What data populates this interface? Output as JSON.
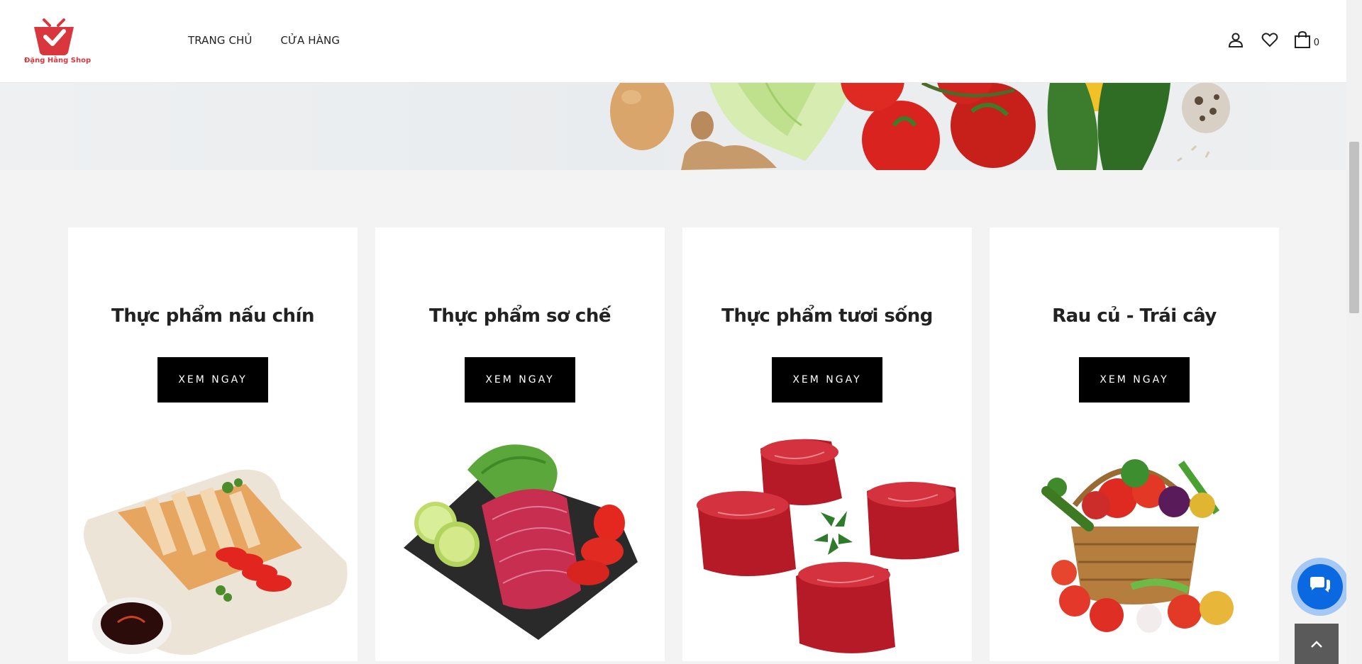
{
  "brand": {
    "name": "Đặng Hằng Shop",
    "color": "#d8383d"
  },
  "nav": {
    "items": [
      {
        "label": "TRANG CHỦ"
      },
      {
        "label": "CỬA HÀNG"
      }
    ]
  },
  "header_icons": {
    "account": "user-icon",
    "wishlist": "heart-icon",
    "cart": "shopping-bag-icon",
    "cart_count": "0"
  },
  "categories": [
    {
      "title": "Thực phẩm nấu chín",
      "button": "XEM NGAY",
      "image": "cooked-food-plate"
    },
    {
      "title": "Thực phẩm sơ chế",
      "button": "XEM NGAY",
      "image": "sliced-tuna-plate"
    },
    {
      "title": "Thực phẩm tươi sống",
      "button": "XEM NGAY",
      "image": "raw-beef-steaks"
    },
    {
      "title": "Rau củ - Trái cây",
      "button": "XEM NGAY",
      "image": "vegetable-basket"
    }
  ],
  "floating": {
    "chat": "chat-icon",
    "back_to_top": "chevron-up-icon"
  },
  "colors": {
    "button_bg": "#000000",
    "chat_blue": "#0a68e0",
    "page_bg": "#f3f3f3"
  }
}
